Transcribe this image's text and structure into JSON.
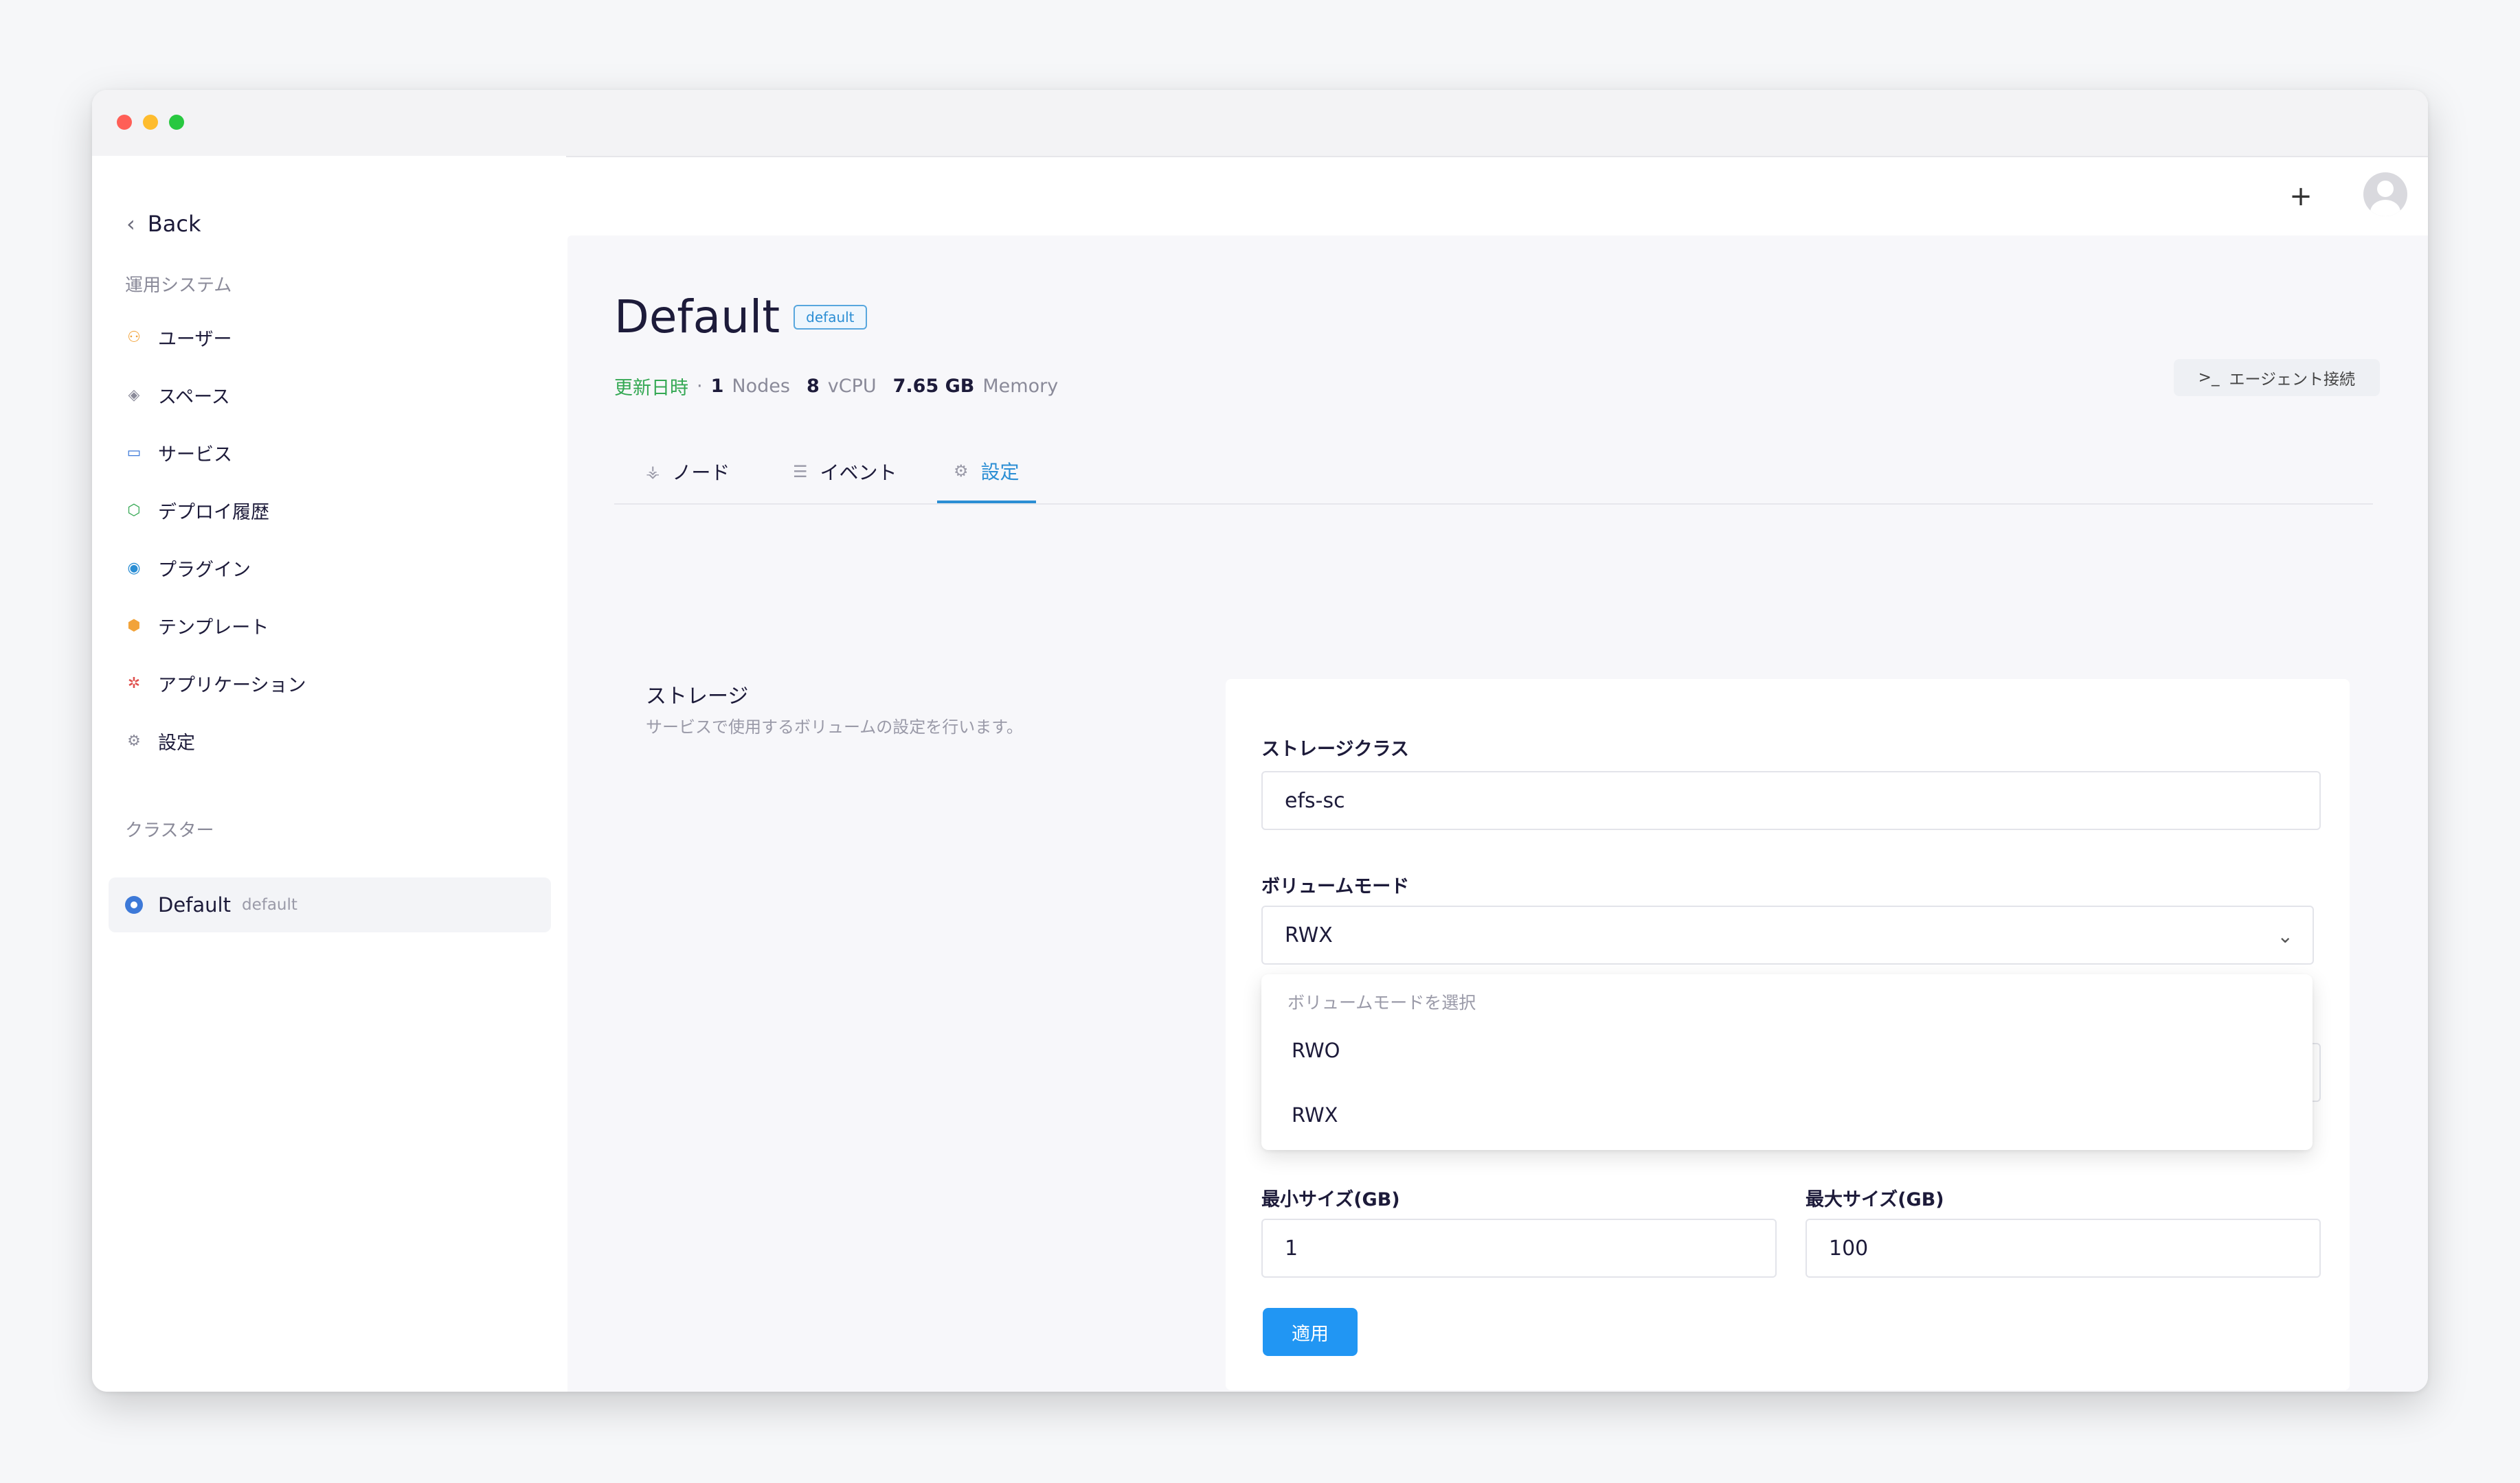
{
  "window": {
    "controls": [
      "close",
      "minimize",
      "maximize"
    ]
  },
  "topbar": {
    "add_icon": "plus-icon",
    "avatar_icon": "user-avatar-icon"
  },
  "sidebar": {
    "back_label": "Back",
    "ops_section_label": "運用システム",
    "items": [
      {
        "label": "ユーザー",
        "icon": "users-icon",
        "color": "#f2a33a"
      },
      {
        "label": "スペース",
        "icon": "layers-icon",
        "color": "#8a8a99"
      },
      {
        "label": "サービス",
        "icon": "window-icon",
        "color": "#3d79d8"
      },
      {
        "label": "デプロイ履歴",
        "icon": "cube-icon",
        "color": "#34a853"
      },
      {
        "label": "プラグイン",
        "icon": "plugin-icon",
        "color": "#2b8ed4"
      },
      {
        "label": "テンプレート",
        "icon": "box-icon",
        "color": "#f2a33a"
      },
      {
        "label": "アプリケーション",
        "icon": "app-icon",
        "color": "#e0504d"
      },
      {
        "label": "設定",
        "icon": "gear-icon",
        "color": "#8a8a99"
      }
    ],
    "cluster_section_label": "クラスター",
    "cluster": {
      "name": "Default",
      "tag": "default"
    }
  },
  "page": {
    "title": "Default",
    "badge": "default",
    "meta": {
      "updated": "更新日時",
      "separator": "·",
      "nodes_value": "1",
      "nodes_unit": "Nodes",
      "cpu_value": "8",
      "cpu_unit": "vCPU",
      "memory_value": "7.65 GB",
      "memory_unit": "Memory"
    },
    "agent_button": "エージェント接続",
    "tabs": [
      {
        "label": "ノード",
        "icon": "node-tree-icon",
        "active": false
      },
      {
        "label": "イベント",
        "icon": "list-icon",
        "active": false
      },
      {
        "label": "設定",
        "icon": "gear-icon",
        "active": true
      }
    ]
  },
  "storage": {
    "title": "ストレージ",
    "description": "サービスで使用するボリュームの設定を行います。",
    "storage_class_label": "ストレージクラス",
    "storage_class_value": "efs-sc",
    "volume_mode_label": "ボリュームモード",
    "volume_mode_value": "RWX",
    "dropdown": {
      "heading": "ボリュームモードを選択",
      "options": [
        "RWO",
        "RWX"
      ]
    },
    "min_size_label": "最小サイズ(GB)",
    "min_size_value": "1",
    "max_size_label": "最大サイズ(GB)",
    "max_size_value": "100",
    "apply_label": "適用"
  },
  "colors": {
    "accent": "#2b8ed4",
    "apply_button": "#2196f3",
    "updated_text": "#34a853"
  }
}
